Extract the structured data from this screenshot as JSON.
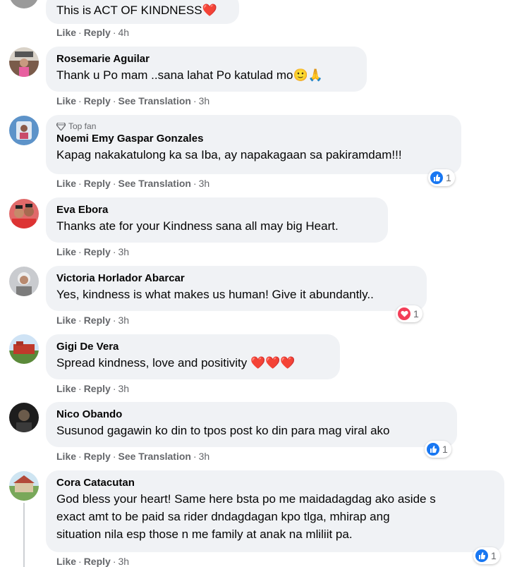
{
  "actions": {
    "like": "Like",
    "reply": "Reply",
    "see_translation": "See Translation",
    "sep": "·"
  },
  "comments": [
    {
      "text": "This is ACT OF KINDNESS",
      "emoji": "❤️",
      "time": "4h"
    },
    {
      "author": "Rosemarie Aguilar",
      "text": "Thank u Po mam ..sana lahat Po katulad mo",
      "emoji": "🙂🙏",
      "time": "3h"
    },
    {
      "badge": "Top fan",
      "author": "Noemi Emy Gaspar Gonzales",
      "text": "Kapag nakakatulong ka sa Iba, ay napakagaan sa pakiramdam!!!",
      "time": "3h",
      "reaction_count": "1"
    },
    {
      "author": "Eva Ebora",
      "text": "Thanks ate for your Kindness sana all may big Heart.",
      "time": "3h"
    },
    {
      "author": "Victoria Horlador Abarcar",
      "text": "Yes, kindness is what makes us human! Give it abundantly..",
      "time": "3h",
      "reaction_count": "1"
    },
    {
      "author": "Gigi De Vera",
      "text": "Spread kindness, love and positivity",
      "emoji": "❤️❤️❤️",
      "time": "3h"
    },
    {
      "author": "Nico Obando",
      "text": "Susunod gagawin ko din to tpos post ko din para mag viral ako",
      "time": "3h",
      "reaction_count": "1"
    },
    {
      "author": "Cora Catacutan",
      "lines": [
        "God bless your heart! Same here bsta po me maidadagdag ako aside s",
        "exact amt to be paid sa rider dndagdagan kpo tlga, mhirap ang",
        "situation nila esp those n me family at anak na mliliit pa."
      ],
      "time": "3h",
      "reaction_count": "1"
    }
  ]
}
